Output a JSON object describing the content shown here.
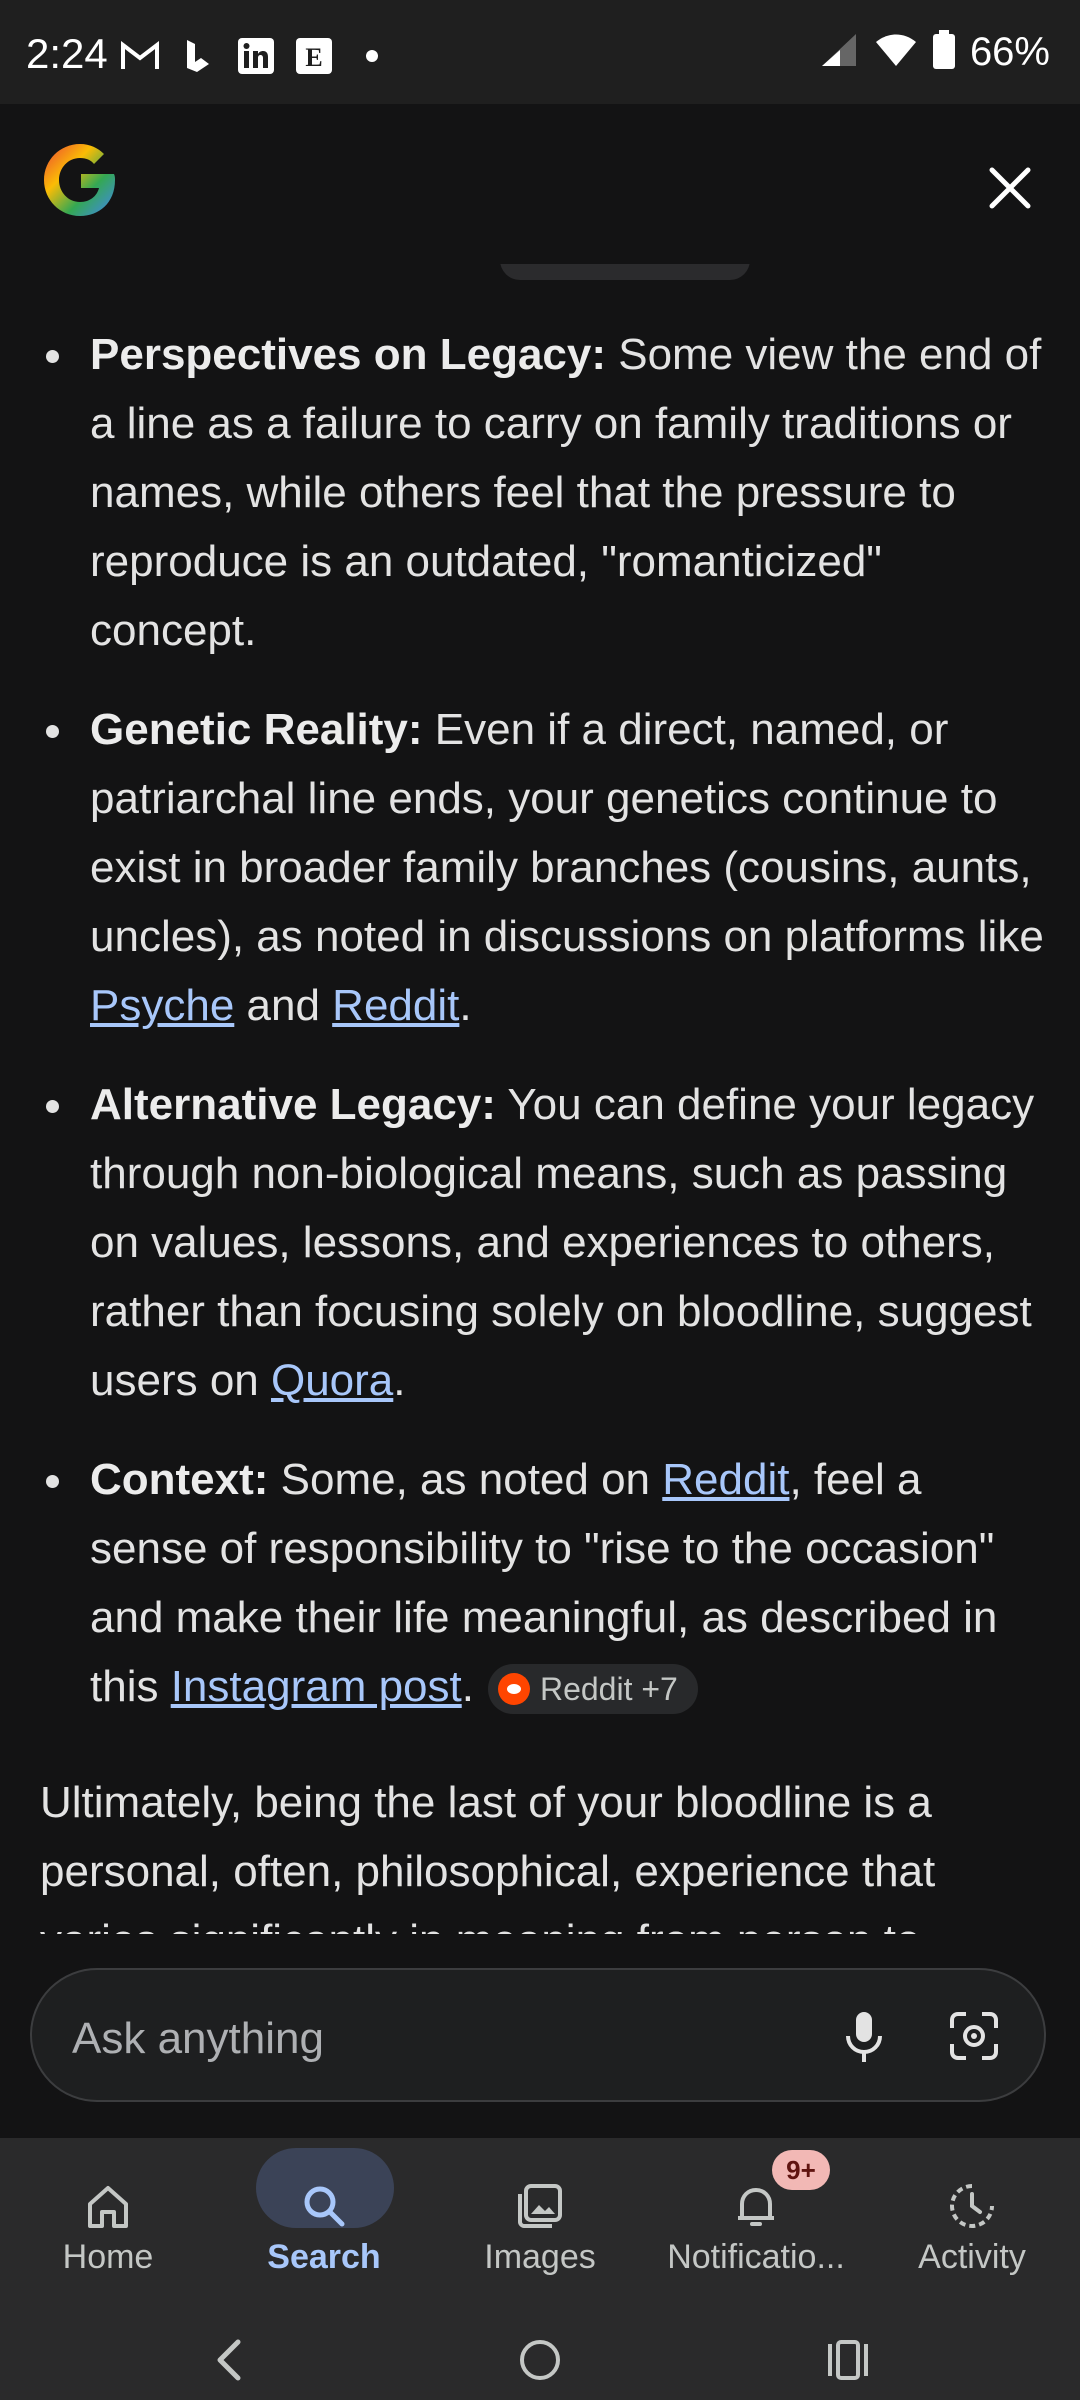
{
  "status_bar": {
    "time": "2:24",
    "notification_icons": [
      "gmail-icon",
      "bing-icon",
      "linkedin-icon",
      "etsy-icon",
      "more-dot-icon"
    ],
    "battery": "66%"
  },
  "header": {
    "logo": "google-g-icon",
    "close": "close-icon"
  },
  "bullets": [
    {
      "term": "Perspectives on Legacy:",
      "text": " Some view the end of a line as a failure to carry on family traditions or names, while others feel that the pressure to reproduce is an outdated, \"romanticized\" concept."
    },
    {
      "term": "Genetic Reality:",
      "text_before": " Even if a direct, named, or patriarchal line ends, your genetics continue to exist in broader family branches (cousins, aunts, uncles), as noted in discussions on platforms like ",
      "link1": "Psyche",
      "mid": " and ",
      "link2": "Reddit",
      "end": "."
    },
    {
      "term": "Alternative Legacy:",
      "text_before": " You can define your legacy through non-biological means, such as passing on values, lessons, and experiences to others, rather than focusing solely on bloodline, suggest users on ",
      "link1": "Quora",
      "end": "."
    },
    {
      "term": "Context:",
      "text_before": " Some, as noted on ",
      "link1": "Reddit",
      "mid": ", feel a sense of responsibility to \"rise to the occasion\" and make their life meaningful, as described in this ",
      "link2": "Instagram post",
      "end": ".",
      "chip": "Reddit +7"
    }
  ],
  "final_paragraph": "Ultimately, being the last of your bloodline is a personal, often, philosophical, experience that varies significantly in meaning from person to",
  "ask_bar": {
    "placeholder": "Ask anything",
    "mic": "mic-icon",
    "lens": "lens-icon"
  },
  "bottom_nav": {
    "items": [
      {
        "label": "Home",
        "icon": "home-icon"
      },
      {
        "label": "Search",
        "icon": "search-icon",
        "active": true
      },
      {
        "label": "Images",
        "icon": "images-icon"
      },
      {
        "label": "Notificatio...",
        "icon": "bell-icon",
        "badge": "9+"
      },
      {
        "label": "Activity",
        "icon": "activity-icon"
      }
    ]
  },
  "colors": {
    "background": "#131314",
    "link": "#a8c7fa",
    "active_pill": "#3b4357",
    "badge": "#f2b8b5"
  }
}
